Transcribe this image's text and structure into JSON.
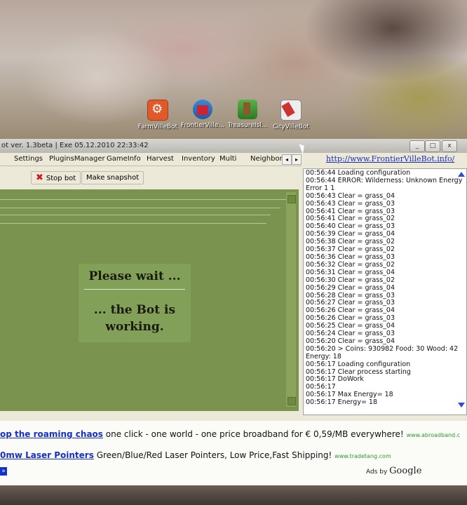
{
  "desktop": {
    "icons": [
      {
        "label": "FarmVilleBot"
      },
      {
        "label": "FrontierVille..."
      },
      {
        "label": "TreasureIsl..."
      },
      {
        "label": "CityVilleBot"
      }
    ]
  },
  "window": {
    "title": "ot ver. 1.3beta | Exe 05.12.2010 22:33:42",
    "min_label": "_",
    "max_label": "□",
    "close_label": "x"
  },
  "menu": {
    "tabs": [
      "Settings",
      "PluginsManager",
      "GameInfo",
      "Harvest",
      "Inventory",
      "Multi",
      "Neighbors"
    ],
    "left_arrow": "◂",
    "right_arrow": "▸",
    "url": "http://www.FrontierVilleBot.info/"
  },
  "toolbar": {
    "stop_icon": "✖",
    "stop_label": "Stop bot",
    "snapshot_label": "Make snapshot"
  },
  "game_panel": {
    "wait_line1": "Please wait ...",
    "wait_line2a": "... the Bot is",
    "wait_line2b": "working."
  },
  "log": [
    "00:56:44 Loading configuration",
    "00:56:44 ERROR: Wilderness: Unknown Energy",
    "Error 1 1",
    "00:56:43 Clear = grass_04",
    "00:56:43 Clear = grass_03",
    "00:56:41 Clear = grass_03",
    "00:56:41 Clear = grass_02",
    "00:56:40 Clear = grass_03",
    "00:56:39 Clear = grass_04",
    "00:56:38 Clear = grass_02",
    "00:56:37 Clear = grass_02",
    "00:56:36 Clear = grass_03",
    "00:56:32 Clear = grass_02",
    "00:56:31 Clear = grass_04",
    "00:56:30 Clear = grass_02",
    "00:56:29 Clear = grass_04",
    "00:56:28 Clear = grass_03",
    "00:56:27 Clear = grass_03",
    "00:56:26 Clear = grass_04",
    "00:56:26 Clear = grass_03",
    "00:56:25 Clear = grass_04",
    "00:56:24 Clear = grass_03",
    "00:56:20 Clear = grass_04",
    "00:56:20 > Coins: 930982 Food: 30 Wood: 42",
    "Energy: 18",
    "00:56:17 Loading configuration",
    "00:56:17 Clear process starting",
    "00:56:17 DoWork",
    "00:56:17",
    "00:56:17 Max Energy= 18",
    "00:56:17 Energy= 18"
  ],
  "ads": {
    "ad1": {
      "title": "op the roaming chaos",
      "body": " one click - one world - one price broadband for € 0,59/MB everywhere!",
      "url": "www.abroadband.c"
    },
    "ad2": {
      "title": "0mw Laser Pointers",
      "body": " Green/Blue/Red Laser Pointers, Low Price,Fast Shipping!",
      "url": "www.tradetang.com"
    },
    "ads_by_prefix": "Ads by ",
    "ads_by_brand": "Google",
    "arrow": "»"
  }
}
